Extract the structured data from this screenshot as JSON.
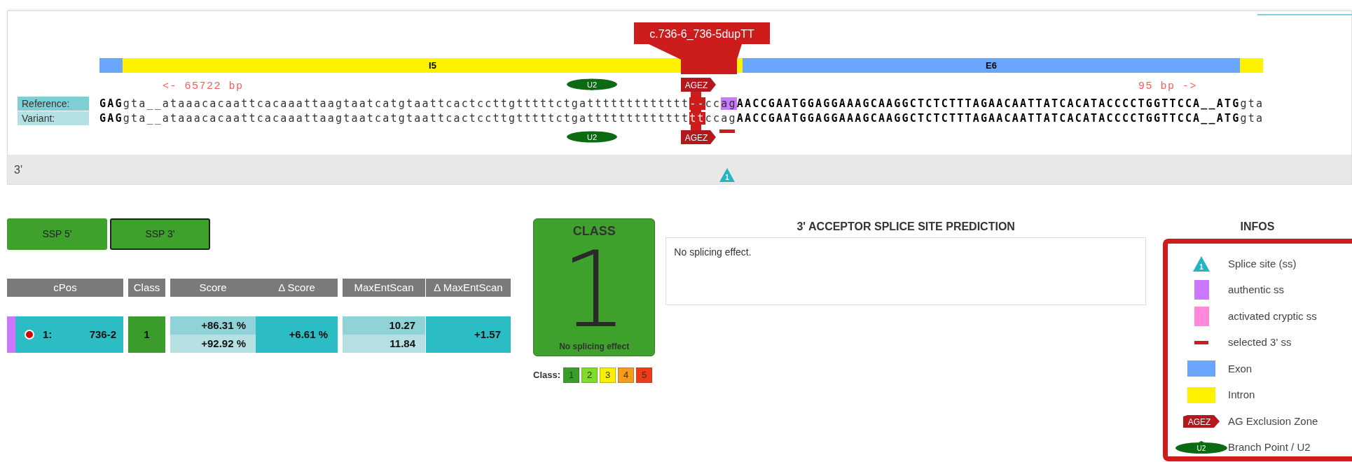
{
  "variant_label": "c.736-6_736-5dupTT",
  "track": [
    {
      "kind": "exon"
    },
    {
      "kind": "intron",
      "label": "I5"
    },
    {
      "kind": "exon",
      "label": "E6"
    },
    {
      "kind": "intron"
    }
  ],
  "upstream_distance": "<- 65722 bp",
  "downstream_distance": "95 bp ->",
  "sequences": [
    {
      "label": "Reference:",
      "segments": [
        {
          "kind": "exon",
          "text": "GAG"
        },
        {
          "kind": "intron",
          "text": "gta__ataaacacaattcacaaattaagtaatcatgtaattcactccttgtttttctgattttttttttttt"
        },
        {
          "kind": "gap",
          "text": "--"
        },
        {
          "kind": "intron",
          "text": "cc"
        },
        {
          "kind": "authentic",
          "text": "ag"
        },
        {
          "kind": "exon",
          "text": "AACCGAATGGAGGAAAGCAAGGCTCTCTTTAGAACAATTATCACATACCCCTGGTTCCA__ATG"
        },
        {
          "kind": "intron",
          "text": "gta"
        }
      ]
    },
    {
      "label": "Variant:",
      "segments": [
        {
          "kind": "exon",
          "text": "GAG"
        },
        {
          "kind": "intron",
          "text": "gta__ataaacacaattcacaaattaagtaatcatgtaattcactccttgtttttctgattttttttttttt"
        },
        {
          "kind": "dup",
          "text": "tt"
        },
        {
          "kind": "intron",
          "text": "ccag"
        },
        {
          "kind": "exon",
          "text": "AACCGAATGGAGGAAAGCAAGGCTCTCTTTAGAACAATTATCACATACCCCTGGTTCCA__ATG"
        },
        {
          "kind": "intron",
          "text": "gta"
        }
      ]
    }
  ],
  "markers_above": [
    {
      "kind": "u2",
      "label": "U2"
    },
    {
      "kind": "agez",
      "label": "AGEZ"
    }
  ],
  "markers_below": [
    {
      "kind": "u2",
      "label": "U2"
    },
    {
      "kind": "agez",
      "label": "AGEZ"
    },
    {
      "kind": "selected"
    }
  ],
  "strand_label": "3'",
  "splice_sites": [
    {
      "label": "1"
    }
  ],
  "buttons": [
    {
      "label": "SSP 5'",
      "selected": false
    },
    {
      "label": "SSP 3'",
      "selected": true
    }
  ],
  "table": {
    "columns": [
      "cPos",
      "Class",
      "Score",
      "Δ Score",
      "MaxEntScan",
      "Δ MaxEntScan"
    ],
    "rows": [
      {
        "selected": true,
        "index": "1:",
        "cpos": "736-2",
        "class": "1",
        "color": "#3a9c2a",
        "score": [
          "+86.31 %",
          "+92.92 %"
        ],
        "delta_score": "+6.61 %",
        "maxent": [
          "10.27",
          "11.84"
        ],
        "delta_maxent": "+1.57"
      }
    ]
  },
  "class_box": {
    "title": "CLASS",
    "value": "1",
    "caption": "No splicing effect",
    "color": "#3ea12b"
  },
  "class_scale": {
    "label": "Class:",
    "items": [
      {
        "label": "1",
        "color": "#3a9c2a"
      },
      {
        "label": "2",
        "color": "#7fdc2a"
      },
      {
        "label": "3",
        "color": "#f8f000"
      },
      {
        "label": "4",
        "color": "#f59a1a"
      },
      {
        "label": "5",
        "color": "#ef3a16"
      }
    ]
  },
  "prediction": {
    "title": "3' ACCEPTOR SPLICE SITE PREDICTION",
    "text": "No splicing effect."
  },
  "infos": {
    "title": "INFOS",
    "items": [
      {
        "kind": "splice_site",
        "icon_text": "1",
        "label": "Splice site (ss)"
      },
      {
        "kind": "authentic",
        "label": "authentic ss"
      },
      {
        "kind": "cryptic",
        "label": "activated cryptic ss"
      },
      {
        "kind": "selected",
        "label": "selected 3' ss"
      },
      {
        "kind": "exon",
        "label": "Exon"
      },
      {
        "kind": "intron",
        "label": "Intron"
      },
      {
        "kind": "agez",
        "icon_text": "AGEZ",
        "label": "AG Exclusion Zone"
      },
      {
        "kind": "u2",
        "icon_text": "U2",
        "label": "Branch Point / U2"
      }
    ]
  }
}
